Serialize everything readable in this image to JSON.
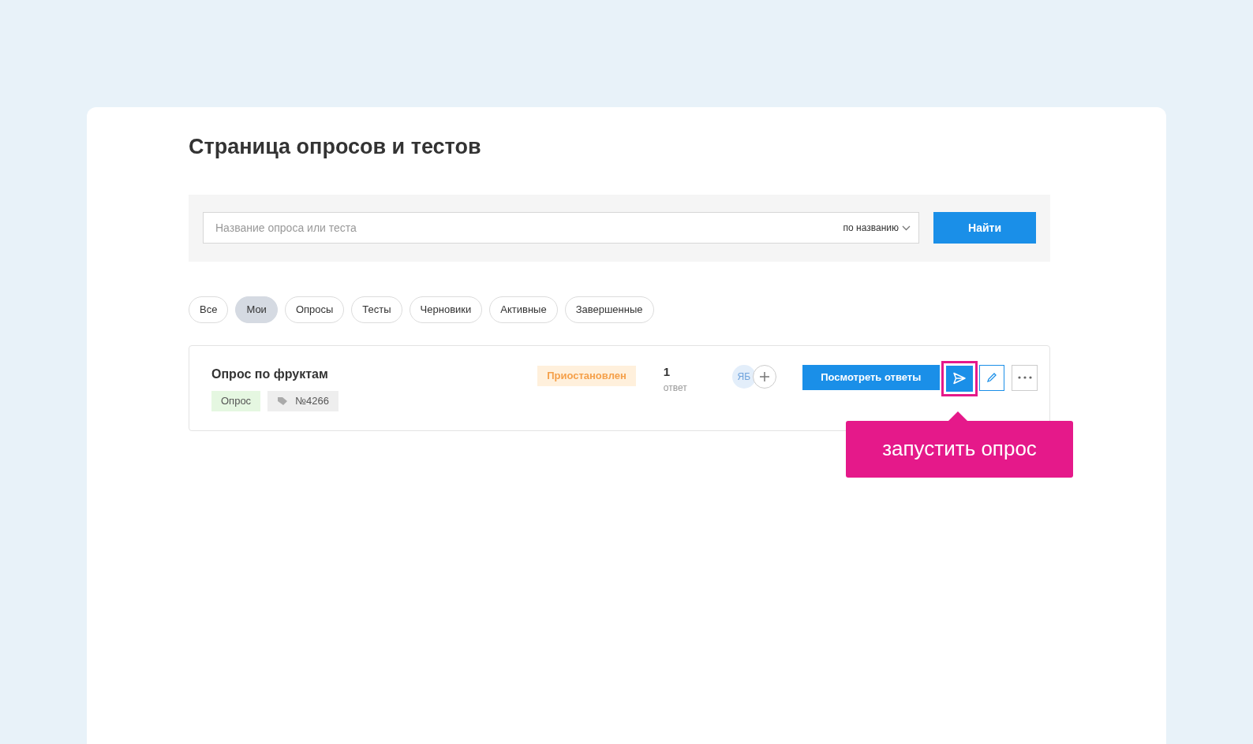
{
  "page_title": "Страница опросов и тестов",
  "search": {
    "placeholder": "Название опроса или теста",
    "mode": "по названию",
    "button": "Найти"
  },
  "filters": [
    {
      "label": "Все",
      "selected": false
    },
    {
      "label": "Мои",
      "selected": true
    },
    {
      "label": "Опросы",
      "selected": false
    },
    {
      "label": "Тесты",
      "selected": false
    },
    {
      "label": "Черновики",
      "selected": false
    },
    {
      "label": "Активные",
      "selected": false
    },
    {
      "label": "Завершенные",
      "selected": false
    }
  ],
  "surveys": [
    {
      "title": "Опрос по фруктам",
      "type_tag": "Опрос",
      "number_tag": "№4266",
      "status": "Приостановлен",
      "answers_count": "1",
      "answers_label": "ответ",
      "avatar": "ЯБ",
      "view_button": "Посмотреть ответы",
      "send_highlighted": true,
      "tooltip": "запустить опрос"
    }
  ]
}
